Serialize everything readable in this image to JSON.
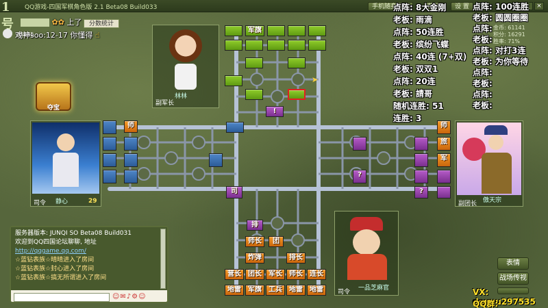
{
  "window": {
    "title": "QQ游戏-四国军棋角色版 2.1 Beta08 Build033",
    "help_button": "帮助",
    "settings_button": "设 置",
    "feedback_button": "手机随身游戏",
    "close_icon": "close-icon"
  },
  "top_left": {
    "logo": "1号",
    "chat_line_1": "上了",
    "chat_line_2": "戏神soo:12-17 你懂得",
    "score_label": "分数统计",
    "id_tag": "35955"
  },
  "treasure": {
    "label": "夺宝"
  },
  "players": {
    "top": {
      "name": "林林",
      "rank": "副军长"
    },
    "left": {
      "name": "静心",
      "rank": "司令",
      "count": "29"
    },
    "right": {
      "name": "傲天宗",
      "rank": "副团长",
      "stats": [
        "金币: 61141",
        "积分: 16291",
        "胜率: 71%"
      ]
    },
    "bottom": {
      "name": "一品芝麻官",
      "rank": "司令"
    }
  },
  "overlay_left": [
    "点阵: 8大金刚",
    "老板: 雨滴",
    "点阵: 50连胜",
    "老板: 缤纷飞蝶",
    "点阵: 40连 (7+双)",
    "老板: 双双1",
    "点阵: 20连",
    "老板: 請哥",
    "随机连胜: 51",
    "连胜: 3"
  ],
  "overlay_right": [
    "点阵: 100连胜",
    "老板: 圆圆圈圈",
    "点阵:",
    "老板:",
    "点阵: 对打3连",
    "老板: 为你等待",
    "点阵:",
    "老板:",
    "点阵:",
    "老板:"
  ],
  "board": {
    "top_pieces": [
      "军旗"
    ],
    "left_pieces": [
      "师",
      "排"
    ],
    "right_pieces": [
      "师",
      "旅",
      "军"
    ],
    "center_piece": "司",
    "bottom_rows": [
      [
        "排"
      ],
      [
        "师长",
        "团"
      ],
      [
        "炸弹",
        "排长"
      ],
      [
        "营长",
        "团长",
        "军长",
        "师长",
        "连长"
      ],
      [
        "地雷",
        "军旗",
        "工兵",
        "地雷",
        "地雷"
      ]
    ],
    "question_mark": "?",
    "exclaim_mark": "!"
  },
  "system_box": {
    "lines": [
      "服务器版本: JUNQI SO Beta08 Build031",
      "欢迎到QQ四国论坛聊聊, 地址",
      "http://qqgame.qq.com/",
      "☆蓝钻表族☆晴晴进入了房间",
      "☆蓝钻表族☆封心进入了房间",
      "☆蓝钻表族☆搞无所谓进入了房间"
    ]
  },
  "side_buttons": {
    "emote": "表情",
    "hide": "战场传视"
  },
  "contact": {
    "vx": "VX:  douyu297535",
    "qq": "QQ群:  491352658"
  }
}
